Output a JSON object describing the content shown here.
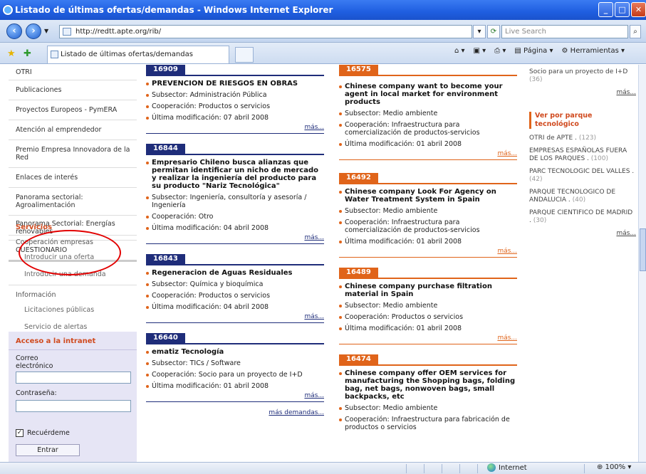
{
  "window": {
    "title": "Listado de últimas ofertas/demandas - Windows Internet Explorer"
  },
  "browser": {
    "address": "http://redtt.apte.org/rib/",
    "search_placeholder": "Live Search",
    "tab_title": "Listado de últimas ofertas/demandas",
    "tool_pagina": "Página",
    "tool_herramientas": "Herramientas",
    "status": "Internet",
    "zoom": "100%"
  },
  "left_menu": {
    "items": [
      "OTRI",
      "Publicaciones",
      "Proyectos Europeos - PymERA",
      "Atención al emprendedor",
      "Premio Empresa Innovadora de la Red",
      "Enlaces de interés",
      "Panorama sectorial: Agroalimentación",
      "Panorama Sectorial: Energías renovables",
      "CUESTIONARIO"
    ],
    "servicios_title": "Servicios",
    "cooperacion": "Cooperación empresas",
    "introducir_oferta": "Introducir una oferta",
    "introducir_demanda": "Introducir una demanda",
    "informacion": "Información",
    "licitaciones": "Licitaciones públicas",
    "alertas": "Servicio de alertas"
  },
  "intranet": {
    "title": "Acceso a la intranet",
    "email_label": "Correo electrónico",
    "password_label": "Contraseña:",
    "remember": "Recuérdeme",
    "enter": "Entrar"
  },
  "col1": [
    {
      "id": "16909",
      "title": "PREVENCION DE RIESGOS EN OBRAS",
      "subsector": "Subsector: Administración Pública",
      "coop": "Cooperación: Productos o servicios",
      "mod": "Última modificación: 07 abril 2008",
      "mas": "más..."
    },
    {
      "id": "16844",
      "title": "Empresario Chileno busca alianzas que permitan identificar un nicho de mercado y realizar la ingeniería del producto para su producto \"Nariz Tecnológica\"",
      "subsector": "Subsector: Ingeniería, consultoría y asesoría / Ingeniería",
      "coop": "Cooperación: Otro",
      "mod": "Última modificación: 04 abril 2008",
      "mas": "más..."
    },
    {
      "id": "16843",
      "title": "Regeneracion de Aguas Residuales",
      "subsector": "Subsector: Química y bioquímica",
      "coop": "Cooperación: Productos o servicios",
      "mod": "Última modificación: 04 abril 2008",
      "mas": "más..."
    },
    {
      "id": "16640",
      "title": "ematiz Tecnología",
      "subsector": "Subsector: TICs / Software",
      "coop": "Cooperación: Socio para un proyecto de I+D",
      "mod": "Última modificación: 01 abril 2008",
      "mas": "más..."
    }
  ],
  "col1_more": "más demandas...",
  "col2": [
    {
      "id": "16575",
      "title": "Chinese company want to become your agent in local market for environment products",
      "subsector": "Subsector: Medio ambiente",
      "coop": "Cooperación: Infraestructura para comercialización de productos-servicios",
      "mod": "Última modificación: 01 abril 2008",
      "mas": "más..."
    },
    {
      "id": "16492",
      "title": "Chinese company Look For Agency on Water Treatment System in Spain",
      "subsector": "Subsector: Medio ambiente",
      "coop": "Cooperación: Infraestructura para comercialización de productos-servicios",
      "mod": "Última modificación: 01 abril 2008",
      "mas": "más..."
    },
    {
      "id": "16489",
      "title": "Chinese company purchase filtration material in Spain",
      "subsector": "Subsector: Medio ambiente",
      "coop": "Cooperación: Productos o servicios",
      "mod": "Última modificación: 01 abril 2008",
      "mas": "más..."
    },
    {
      "id": "16474",
      "title": "Chinese company offer OEM services for manufacturing the Shopping bags, folding bag, net bags, nonwoven bags, small backpacks, etc",
      "subsector": "Subsector: Medio ambiente",
      "coop": "Cooperación: Infraestructura para fabricación de productos o servicios"
    }
  ],
  "right": {
    "top_text": "Socio para un proyecto de I+D",
    "top_count": "(36)",
    "top_mas": "más...",
    "header": "Ver por parque tecnológico",
    "parks": [
      {
        "name": "OTRI de APTE .",
        "count": "(123)"
      },
      {
        "name": "EMPRESAS ESPAÑOLAS FUERA DE LOS PARQUES .",
        "count": "(100)"
      },
      {
        "name": "PARC TECNOLOGIC DEL VALLES .",
        "count": "(42)"
      },
      {
        "name": "PARQUE TECNOLOGICO DE ANDALUCIA .",
        "count": "(40)"
      },
      {
        "name": "PARQUE CIENTIFICO DE MADRID .",
        "count": "(30)"
      }
    ],
    "mas": "más..."
  }
}
